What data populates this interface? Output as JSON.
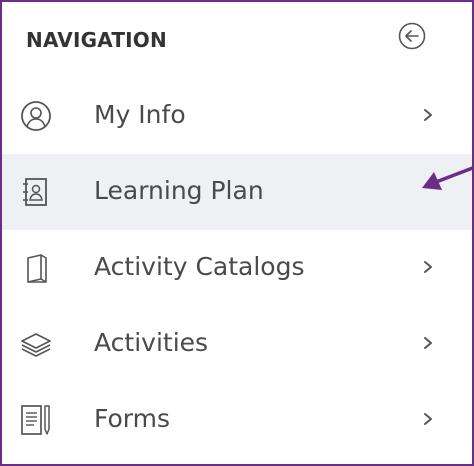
{
  "navigation": {
    "title": "NAVIGATION",
    "items": [
      {
        "label": "My Info",
        "icon": "user-circle-icon",
        "has_submenu": true,
        "active": false
      },
      {
        "label": "Learning Plan",
        "icon": "contact-book-icon",
        "has_submenu": false,
        "active": true
      },
      {
        "label": "Activity Catalogs",
        "icon": "book-icon",
        "has_submenu": true,
        "active": false
      },
      {
        "label": "Activities",
        "icon": "layers-icon",
        "has_submenu": true,
        "active": false
      },
      {
        "label": "Forms",
        "icon": "form-pen-icon",
        "has_submenu": true,
        "active": false
      }
    ]
  },
  "colors": {
    "frame_border": "#6a2e87",
    "active_background": "#eef0f3",
    "annotation_arrow": "#6a2e87",
    "text": "#4a4a4a",
    "title_text": "#333333"
  }
}
